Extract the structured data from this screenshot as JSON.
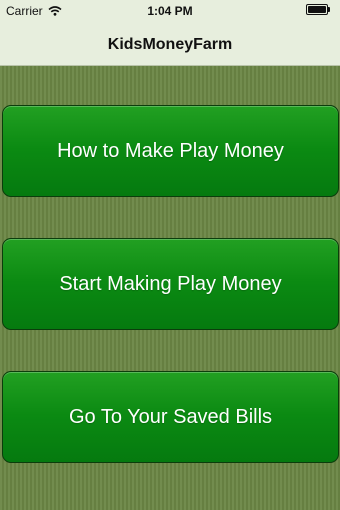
{
  "status_bar": {
    "carrier": "Carrier",
    "time": "1:04 PM",
    "wifi_icon": "wifi-icon",
    "battery_icon": "battery-icon",
    "battery_level": 1.0
  },
  "nav_bar": {
    "title": "KidsMoneyFarm"
  },
  "menu": {
    "buttons": [
      {
        "label": "How to Make Play Money"
      },
      {
        "label": "Start Making Play Money"
      },
      {
        "label": "Go To Your Saved Bills"
      }
    ]
  },
  "colors": {
    "button_green": "#0b8a12",
    "background_green": "#6b8644",
    "nav_bar_background": "#e7eedd"
  }
}
